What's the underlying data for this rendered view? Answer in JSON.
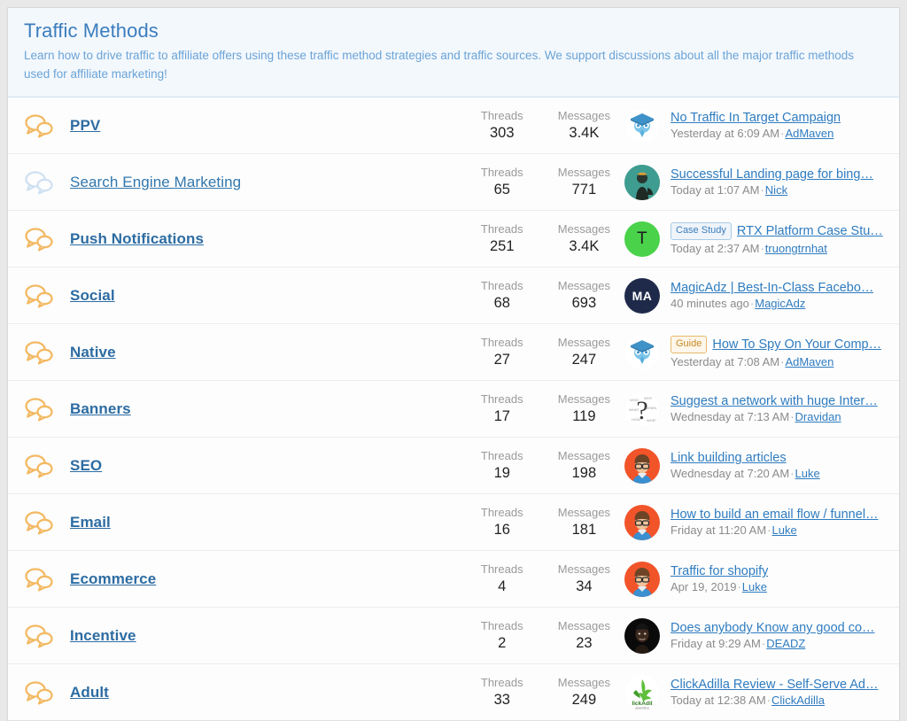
{
  "category": {
    "title": "Traffic Methods",
    "description": "Learn how to drive traffic to affiliate offers using these traffic method strategies and traffic sources. We support discussions about all the major traffic methods used for affiliate marketing!"
  },
  "labels": {
    "threads": "Threads",
    "messages": "Messages",
    "separator": "·"
  },
  "colors": {
    "header_bg": "#f3f8fd",
    "title": "#3b7dbd",
    "description": "#6ba3d6",
    "link": "#2f7cc0",
    "unread_icon": "#f3b963",
    "read_icon": "#cfe1f2",
    "badge_blue": "#3b7dbd",
    "badge_orange": "#c98a24"
  },
  "forums": [
    {
      "name": "PPV",
      "unread": true,
      "threads_label": "Threads",
      "threads": "303",
      "messages_label": "Messages",
      "messages": "3.4K",
      "last_post": {
        "badge": "",
        "title": "No Traffic In Target Campaign",
        "time": "Yesterday at 6:09 AM",
        "user": "AdMaven",
        "avatar": "admaven-owl-avatar"
      }
    },
    {
      "name": "Search Engine Marketing",
      "unread": false,
      "threads_label": "Threads",
      "threads": "65",
      "messages_label": "Messages",
      "messages": "771",
      "last_post": {
        "badge": "",
        "title": "Successful Landing page for bing…",
        "time": "Today at 1:07 AM",
        "user": "Nick",
        "avatar": "nick-teal-avatar"
      }
    },
    {
      "name": "Push Notifications",
      "unread": true,
      "threads_label": "Threads",
      "threads": "251",
      "messages_label": "Messages",
      "messages": "3.4K",
      "last_post": {
        "badge": "Case Study",
        "badge_type": "blue",
        "title": "RTX Platform Case Stu…",
        "time": "Today at 2:37 AM",
        "user": "truongtrnhat",
        "avatar": "truongtrnhat-green-letter-avatar",
        "avatar_letter": "T"
      }
    },
    {
      "name": "Social",
      "unread": true,
      "threads_label": "Threads",
      "threads": "68",
      "messages_label": "Messages",
      "messages": "693",
      "last_post": {
        "badge": "",
        "title": "MagicAdz | Best-In-Class Facebo…",
        "time": "40 minutes ago",
        "user": "MagicAdz",
        "avatar": "magicadz-navy-letter-avatar",
        "avatar_letter": "MA"
      }
    },
    {
      "name": "Native",
      "unread": true,
      "threads_label": "Threads",
      "threads": "27",
      "messages_label": "Messages",
      "messages": "247",
      "last_post": {
        "badge": "Guide",
        "badge_type": "orange",
        "title": "How To Spy On Your Comp…",
        "time": "Yesterday at 7:08 AM",
        "user": "AdMaven",
        "avatar": "admaven-owl-avatar"
      }
    },
    {
      "name": "Banners",
      "unread": true,
      "threads_label": "Threads",
      "threads": "17",
      "messages_label": "Messages",
      "messages": "119",
      "last_post": {
        "badge": "",
        "title": "Suggest a network with huge Inter…",
        "time": "Wednesday at 7:13 AM",
        "user": "Dravidan",
        "avatar": "dravidan-question-mark-avatar"
      }
    },
    {
      "name": "SEO",
      "unread": true,
      "threads_label": "Threads",
      "threads": "19",
      "messages_label": "Messages",
      "messages": "198",
      "last_post": {
        "badge": "",
        "title": "Link building articles",
        "time": "Wednesday at 7:20 AM",
        "user": "Luke",
        "avatar": "luke-cartoon-avatar"
      }
    },
    {
      "name": "Email",
      "unread": true,
      "threads_label": "Threads",
      "threads": "16",
      "messages_label": "Messages",
      "messages": "181",
      "last_post": {
        "badge": "",
        "title": "How to build an email flow / funnel…",
        "time": "Friday at 11:20 AM",
        "user": "Luke",
        "avatar": "luke-cartoon-avatar"
      }
    },
    {
      "name": "Ecommerce",
      "unread": true,
      "threads_label": "Threads",
      "threads": "4",
      "messages_label": "Messages",
      "messages": "34",
      "last_post": {
        "badge": "",
        "title": "Traffic for shopify",
        "time": "Apr 19, 2019",
        "user": "Luke",
        "avatar": "luke-cartoon-avatar"
      }
    },
    {
      "name": "Incentive",
      "unread": true,
      "threads_label": "Threads",
      "threads": "2",
      "messages_label": "Messages",
      "messages": "23",
      "last_post": {
        "badge": "",
        "title": "Does anybody Know any good co…",
        "time": "Friday at 9:29 AM",
        "user": "DEADZ",
        "avatar": "deadz-photo-avatar"
      }
    },
    {
      "name": "Adult",
      "unread": true,
      "threads_label": "Threads",
      "threads": "33",
      "messages_label": "Messages",
      "messages": "249",
      "last_post": {
        "badge": "",
        "title": "ClickAdilla Review - Self-Serve Ad…",
        "time": "Today at 12:38 AM",
        "user": "ClickAdilla",
        "avatar": "clickadilla-logo-avatar"
      }
    }
  ]
}
